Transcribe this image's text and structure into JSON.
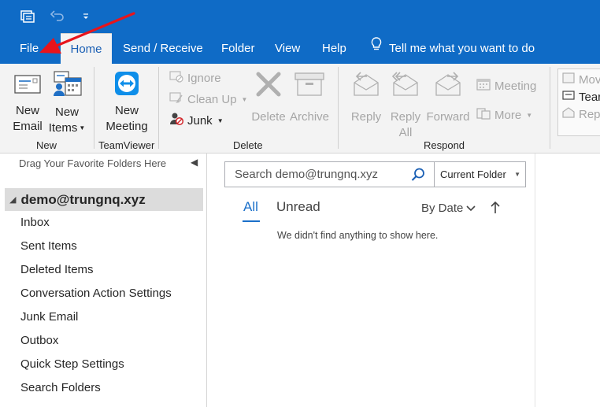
{
  "tabs": {
    "file": "File",
    "home": "Home",
    "send_receive": "Send / Receive",
    "folder": "Folder",
    "view": "View",
    "help": "Help",
    "tell_me": "Tell me what you want to do"
  },
  "ribbon": {
    "new_email": [
      "New",
      "Email"
    ],
    "new_items": [
      "New",
      "Items"
    ],
    "new_meeting": [
      "New",
      "Meeting"
    ],
    "group_new": "New",
    "group_teamviewer": "TeamViewer",
    "ignore": "Ignore",
    "clean_up": "Clean Up",
    "junk": "Junk",
    "delete": "Delete",
    "archive": "Archive",
    "group_delete": "Delete",
    "reply": "Reply",
    "reply_all": [
      "Reply",
      "All"
    ],
    "forward": "Forward",
    "meeting": "Meeting",
    "more": "More",
    "group_respond": "Respond",
    "move_partial": "Mov",
    "team_partial": "Tear",
    "rep_partial": "Rep"
  },
  "folder_pane": {
    "fav_hint": "Drag Your Favorite Folders Here",
    "account": "demo@trungnq.xyz",
    "folders": [
      "Inbox",
      "Sent Items",
      "Deleted Items",
      "Conversation Action Settings",
      "Junk Email",
      "Outbox",
      "Quick Step Settings",
      "Search Folders"
    ]
  },
  "message_list": {
    "search_placeholder": "Search demo@trungnq.xyz",
    "scope": "Current Folder",
    "filter_all": "All",
    "filter_unread": "Unread",
    "sort": "By Date",
    "empty": "We didn't find anything to show here."
  },
  "colors": {
    "accent": "#0f6bc6",
    "annotation_arrow": "#e8141b"
  }
}
